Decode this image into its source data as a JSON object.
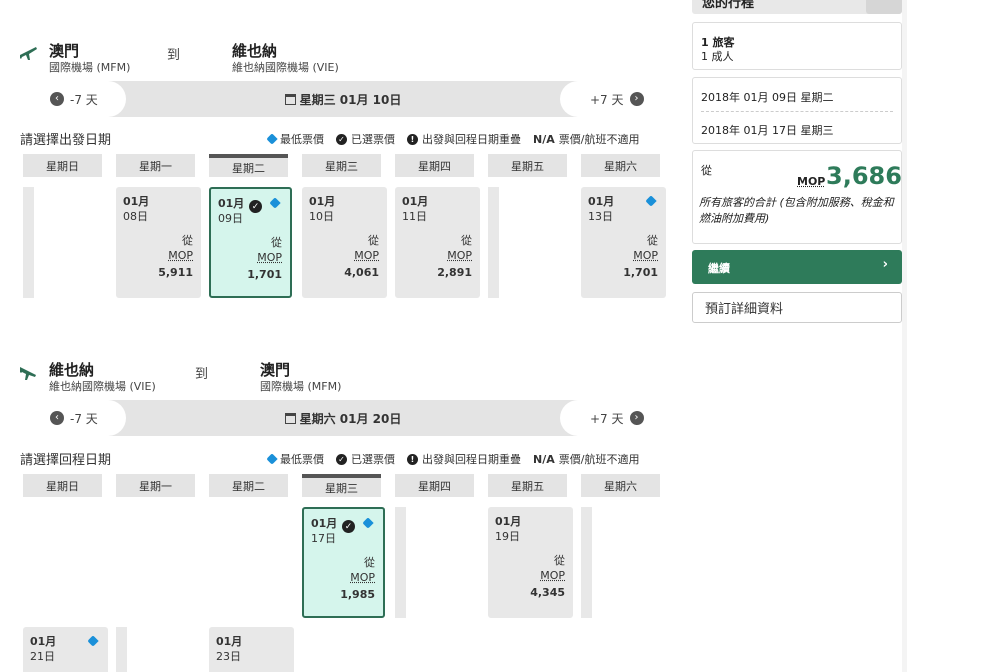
{
  "outbound": {
    "from_city": "澳門",
    "from_airport": "國際機場 (MFM)",
    "to_label": "到",
    "to_city": "維也納",
    "to_airport": "維也納國際機場 (VIE)",
    "nav": {
      "prev": "-7 天",
      "center": "星期三 01月 10日",
      "next": "+7 天"
    },
    "select_label": "請選擇出發日期",
    "weekdays": [
      "星期日",
      "星期一",
      "星期二",
      "星期三",
      "星期四",
      "星期五",
      "星期六"
    ],
    "cells": [
      {
        "month": "01月",
        "day": "08日",
        "from": "從",
        "currency": "MOP",
        "price": "5,911"
      },
      {
        "month": "01月",
        "day": "09日",
        "from": "從",
        "currency": "MOP",
        "price": "1,701"
      },
      {
        "month": "01月",
        "day": "10日",
        "from": "從",
        "currency": "MOP",
        "price": "4,061"
      },
      {
        "month": "01月",
        "day": "11日",
        "from": "從",
        "currency": "MOP",
        "price": "2,891"
      },
      {
        "month": "01月",
        "day": "13日",
        "from": "從",
        "currency": "MOP",
        "price": "1,701"
      }
    ]
  },
  "inbound": {
    "from_city": "維也納",
    "from_airport": "維也納國際機場 (VIE)",
    "to_label": "到",
    "to_city": "澳門",
    "to_airport": "國際機場 (MFM)",
    "nav": {
      "prev": "-7 天",
      "center": "星期六 01月 20日",
      "next": "+7 天"
    },
    "select_label": "請選擇回程日期",
    "weekdays": [
      "星期日",
      "星期一",
      "星期二",
      "星期三",
      "星期四",
      "星期五",
      "星期六"
    ],
    "cells": [
      {
        "month": "01月",
        "day": "17日",
        "from": "從",
        "currency": "MOP",
        "price": "1,985"
      },
      {
        "month": "01月",
        "day": "19日",
        "from": "從",
        "currency": "MOP",
        "price": "4,345"
      },
      {
        "month": "01月",
        "day": "21日"
      },
      {
        "month": "01月",
        "day": "23日"
      }
    ]
  },
  "legend": {
    "lowest": "最低票價",
    "selected": "已選票價",
    "overlap": "出發與回程日期重疊",
    "na_code": "N/A",
    "na_text": "票價/航班不適用"
  },
  "summary": {
    "heading": "您的行程",
    "travelers_count": "1 旅客",
    "travelers_type": "1 成人",
    "depart_date": "2018年 01月 09日 星期二",
    "return_date": "2018年 01月 17日 星期三",
    "from": "從",
    "currency": "MOP",
    "total": "3,686",
    "total_note": "所有旅客的合計 (包含附加服務、稅金和燃油附加費用)",
    "continue": "繼續",
    "details": "預訂詳細資料"
  },
  "colors": {
    "accent": "#2e7b5a",
    "selected_bg": "#d5f5ec",
    "tag": "#1a90d9"
  }
}
